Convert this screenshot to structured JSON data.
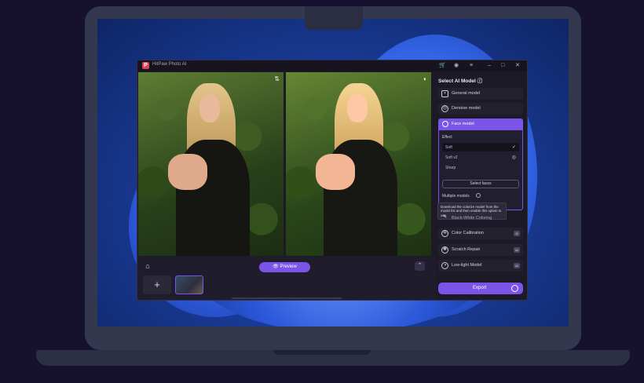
{
  "app": {
    "title": "HitPaw Photo AI",
    "logo_letter": "P",
    "titlebar_icons": [
      "cart-icon",
      "account-icon",
      "menu-icon",
      "minimize-icon",
      "maximize-icon",
      "close-icon"
    ]
  },
  "canvas": {
    "compare_icon": "⇅",
    "preview_label": "Preview",
    "add_label": "+",
    "collapse_label": "⌃"
  },
  "panel": {
    "title": "Select AI Model",
    "models": [
      {
        "label": "General model",
        "icon": "image-icon"
      },
      {
        "label": "Denoise model",
        "icon": "denoise-icon"
      }
    ],
    "face_model": {
      "label": "Face model",
      "effect_label": "Effect",
      "options": [
        {
          "label": "Soft",
          "selected": true,
          "mark": "✓"
        },
        {
          "label": "Soft v2",
          "selected": false,
          "mark": "◎"
        },
        {
          "label": "Sharp",
          "selected": false,
          "mark": ""
        }
      ],
      "select_faces_label": "Select faces",
      "multiple_models_label": "Multiple models",
      "tooltip": "Download the colorize model from the model list and then enable this option to use."
    },
    "more_models": [
      {
        "label": "Black-White Coloring"
      },
      {
        "label": "Color Calibration",
        "badge": "◎"
      },
      {
        "label": "Scratch Repair",
        "badge": "AI"
      },
      {
        "label": "Low-light Model",
        "badge": "AI"
      }
    ],
    "export_label": "Export"
  },
  "colors": {
    "accent": "#7b54e8",
    "window_bg": "#1c1a27"
  }
}
